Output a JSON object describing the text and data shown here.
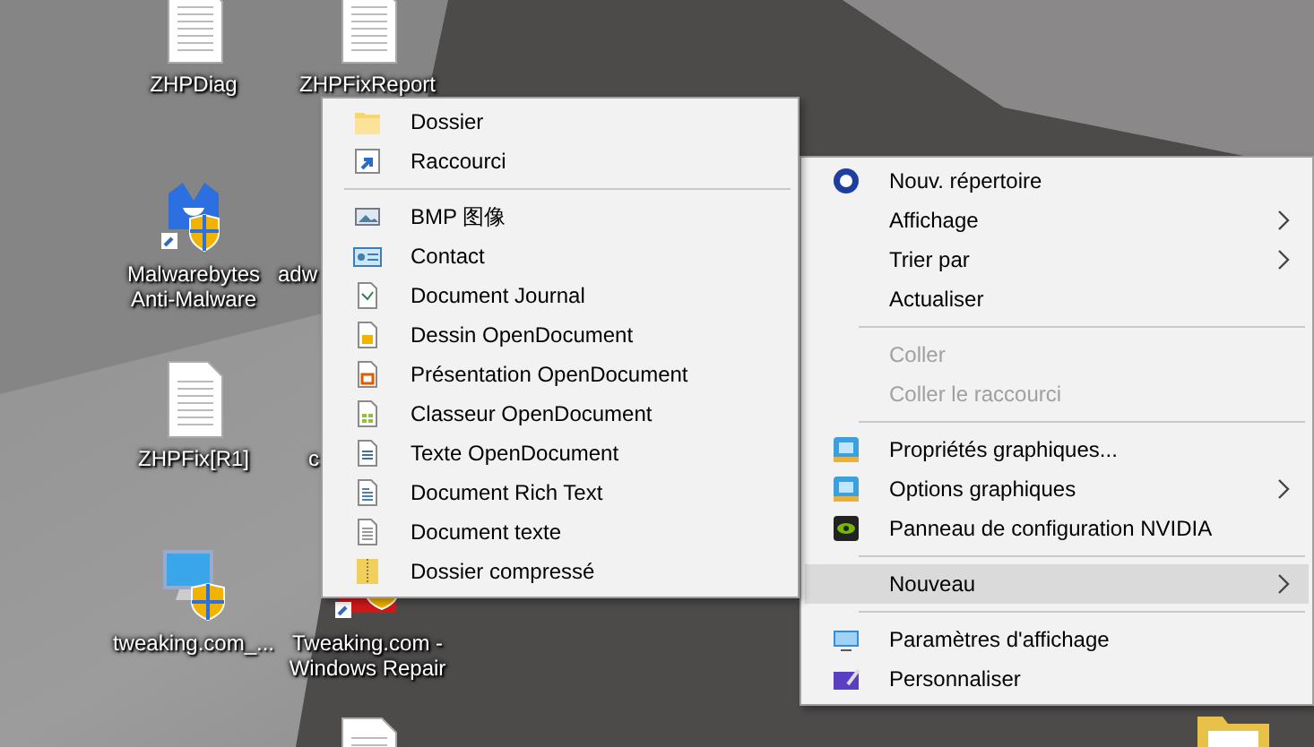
{
  "desktop": {
    "icons": [
      {
        "label": "ZHPDiag",
        "kind": "document"
      },
      {
        "label": "ZHPFixReport",
        "kind": "document"
      },
      {
        "label": "Malwarebytes Anti-Malware",
        "kind": "malware-app"
      },
      {
        "label": "adw",
        "kind": "hidden"
      },
      {
        "label": "ZHPFix[R1]",
        "kind": "document"
      },
      {
        "label": "c",
        "kind": "hidden"
      },
      {
        "label": "tweaking.com_...",
        "kind": "monitor-app"
      },
      {
        "label": "Tweaking.com - Windows Repair",
        "kind": "repair-app"
      },
      {
        "kind": "document"
      },
      {
        "kind": "folder"
      }
    ]
  },
  "context_menu": {
    "items": [
      {
        "kind": "item",
        "label": "Nouv. répertoire",
        "disabled": false,
        "submenu": false,
        "selected": false
      },
      {
        "kind": "item",
        "label": "Affichage",
        "disabled": false,
        "submenu": true,
        "selected": false
      },
      {
        "kind": "item",
        "label": "Trier par",
        "disabled": false,
        "submenu": true,
        "selected": false
      },
      {
        "kind": "item",
        "label": "Actualiser",
        "disabled": false,
        "submenu": false,
        "selected": false
      },
      {
        "kind": "separator"
      },
      {
        "kind": "item",
        "label": "Coller",
        "disabled": true,
        "submenu": false,
        "selected": false
      },
      {
        "kind": "item",
        "label": "Coller le raccourci",
        "disabled": true,
        "submenu": false,
        "selected": false
      },
      {
        "kind": "separator"
      },
      {
        "kind": "item",
        "label": "Propriétés graphiques...",
        "disabled": false,
        "submenu": false,
        "selected": false
      },
      {
        "kind": "item",
        "label": "Options graphiques",
        "disabled": false,
        "submenu": true,
        "selected": false
      },
      {
        "kind": "item",
        "label": "Panneau de configuration NVIDIA",
        "disabled": false,
        "submenu": false,
        "selected": false
      },
      {
        "kind": "separator"
      },
      {
        "kind": "item",
        "label": "Nouveau",
        "disabled": false,
        "submenu": true,
        "selected": true
      },
      {
        "kind": "separator"
      },
      {
        "kind": "item",
        "label": "Paramètres d'affichage",
        "disabled": false,
        "submenu": false,
        "selected": false
      },
      {
        "kind": "item",
        "label": "Personnaliser",
        "disabled": false,
        "submenu": false,
        "selected": false
      }
    ]
  },
  "new_submenu": {
    "items": [
      {
        "kind": "item",
        "label": "Dossier"
      },
      {
        "kind": "item",
        "label": "Raccourci"
      },
      {
        "kind": "separator"
      },
      {
        "kind": "item",
        "label": "BMP 图像"
      },
      {
        "kind": "item",
        "label": "Contact"
      },
      {
        "kind": "item",
        "label": "Document Journal"
      },
      {
        "kind": "item",
        "label": "Dessin OpenDocument"
      },
      {
        "kind": "item",
        "label": "Présentation OpenDocument"
      },
      {
        "kind": "item",
        "label": "Classeur OpenDocument"
      },
      {
        "kind": "item",
        "label": "Texte OpenDocument"
      },
      {
        "kind": "item",
        "label": "Document Rich Text"
      },
      {
        "kind": "item",
        "label": "Document texte"
      },
      {
        "kind": "item",
        "label": "Dossier compressé"
      }
    ]
  }
}
